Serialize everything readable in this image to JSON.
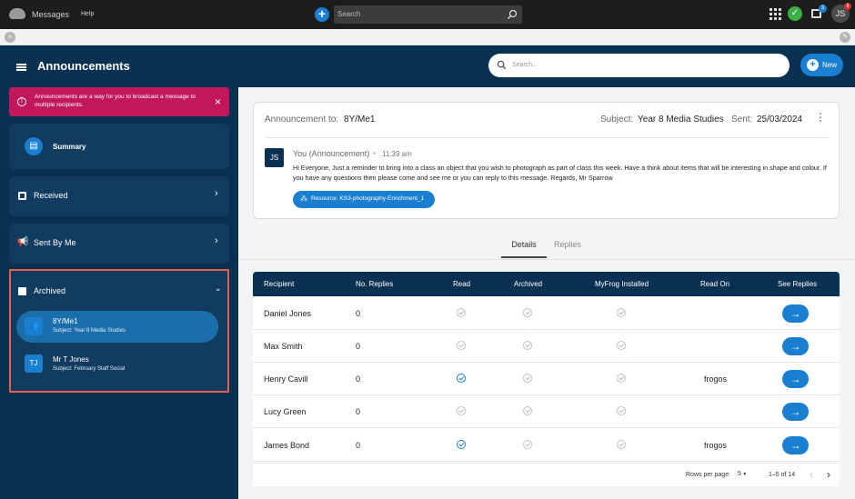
{
  "topbar": {
    "app_title": "Messages",
    "help_label": "Help",
    "search_placeholder": "Search",
    "notif_badge": "3",
    "alert_badge": "8",
    "user_initials": "JS"
  },
  "header": {
    "title": "Announcements",
    "search_placeholder": "Search...",
    "new_label": "New"
  },
  "sidebar": {
    "info_text": "Announcements are a way for you to broadcast a message to multiple recipients.",
    "summary_label": "Summary",
    "received_label": "Received",
    "sent_label": "Sent By Me",
    "archived_label": "Archived",
    "archived_items": [
      {
        "initials": "",
        "title": "8Y/Me1",
        "subtitle": "Subject: Year 8 Media Studies"
      },
      {
        "initials": "TJ",
        "title": "Mr T Jones",
        "subtitle": "Subject: February Staff Social"
      }
    ]
  },
  "announcement": {
    "to_label": "Announcement to:",
    "to_value": "8Y/Me1",
    "subject_label": "Subject:",
    "subject_value": "Year 8 Media Studies",
    "sent_label": "Sent:",
    "sent_value": "25/03/2024",
    "author_initials": "JS",
    "author": "You (Announcement)",
    "time": "11:39 am",
    "body": "Hi Everyone, Just a reminder to bring into a class an object that you wish to photograph as part of class this week. Have a think about items that will be interesting in shape and colour. If you have any questions then please come and see me or you can reply to this message. Regards, Mr Sparrow",
    "resource": "Resource: KS3-photography-Enrichment_1"
  },
  "tabs": {
    "details": "Details",
    "replies": "Replies"
  },
  "table": {
    "headers": [
      "Recipient",
      "No. Replies",
      "Read",
      "Archived",
      "MyFrog Installed",
      "Read On",
      "See Replies"
    ],
    "rows": [
      {
        "recipient": "Daniel Jones",
        "replies": "0",
        "read": false,
        "read_on": ""
      },
      {
        "recipient": "Max Smith",
        "replies": "0",
        "read": false,
        "read_on": ""
      },
      {
        "recipient": "Henry Cavill",
        "replies": "0",
        "read": true,
        "read_on": "frogos"
      },
      {
        "recipient": "Lucy Green",
        "replies": "0",
        "read": false,
        "read_on": ""
      },
      {
        "recipient": "James Bond",
        "replies": "0",
        "read": true,
        "read_on": "frogos"
      }
    ],
    "rows_per_page_label": "Rows per page:",
    "rows_per_page": "5",
    "range": "1–5 of 14"
  },
  "colors": {
    "accent": "#1a7fd1",
    "navy": "#0a3052",
    "alert": "#c2185b",
    "highlight": "#e5604a"
  }
}
